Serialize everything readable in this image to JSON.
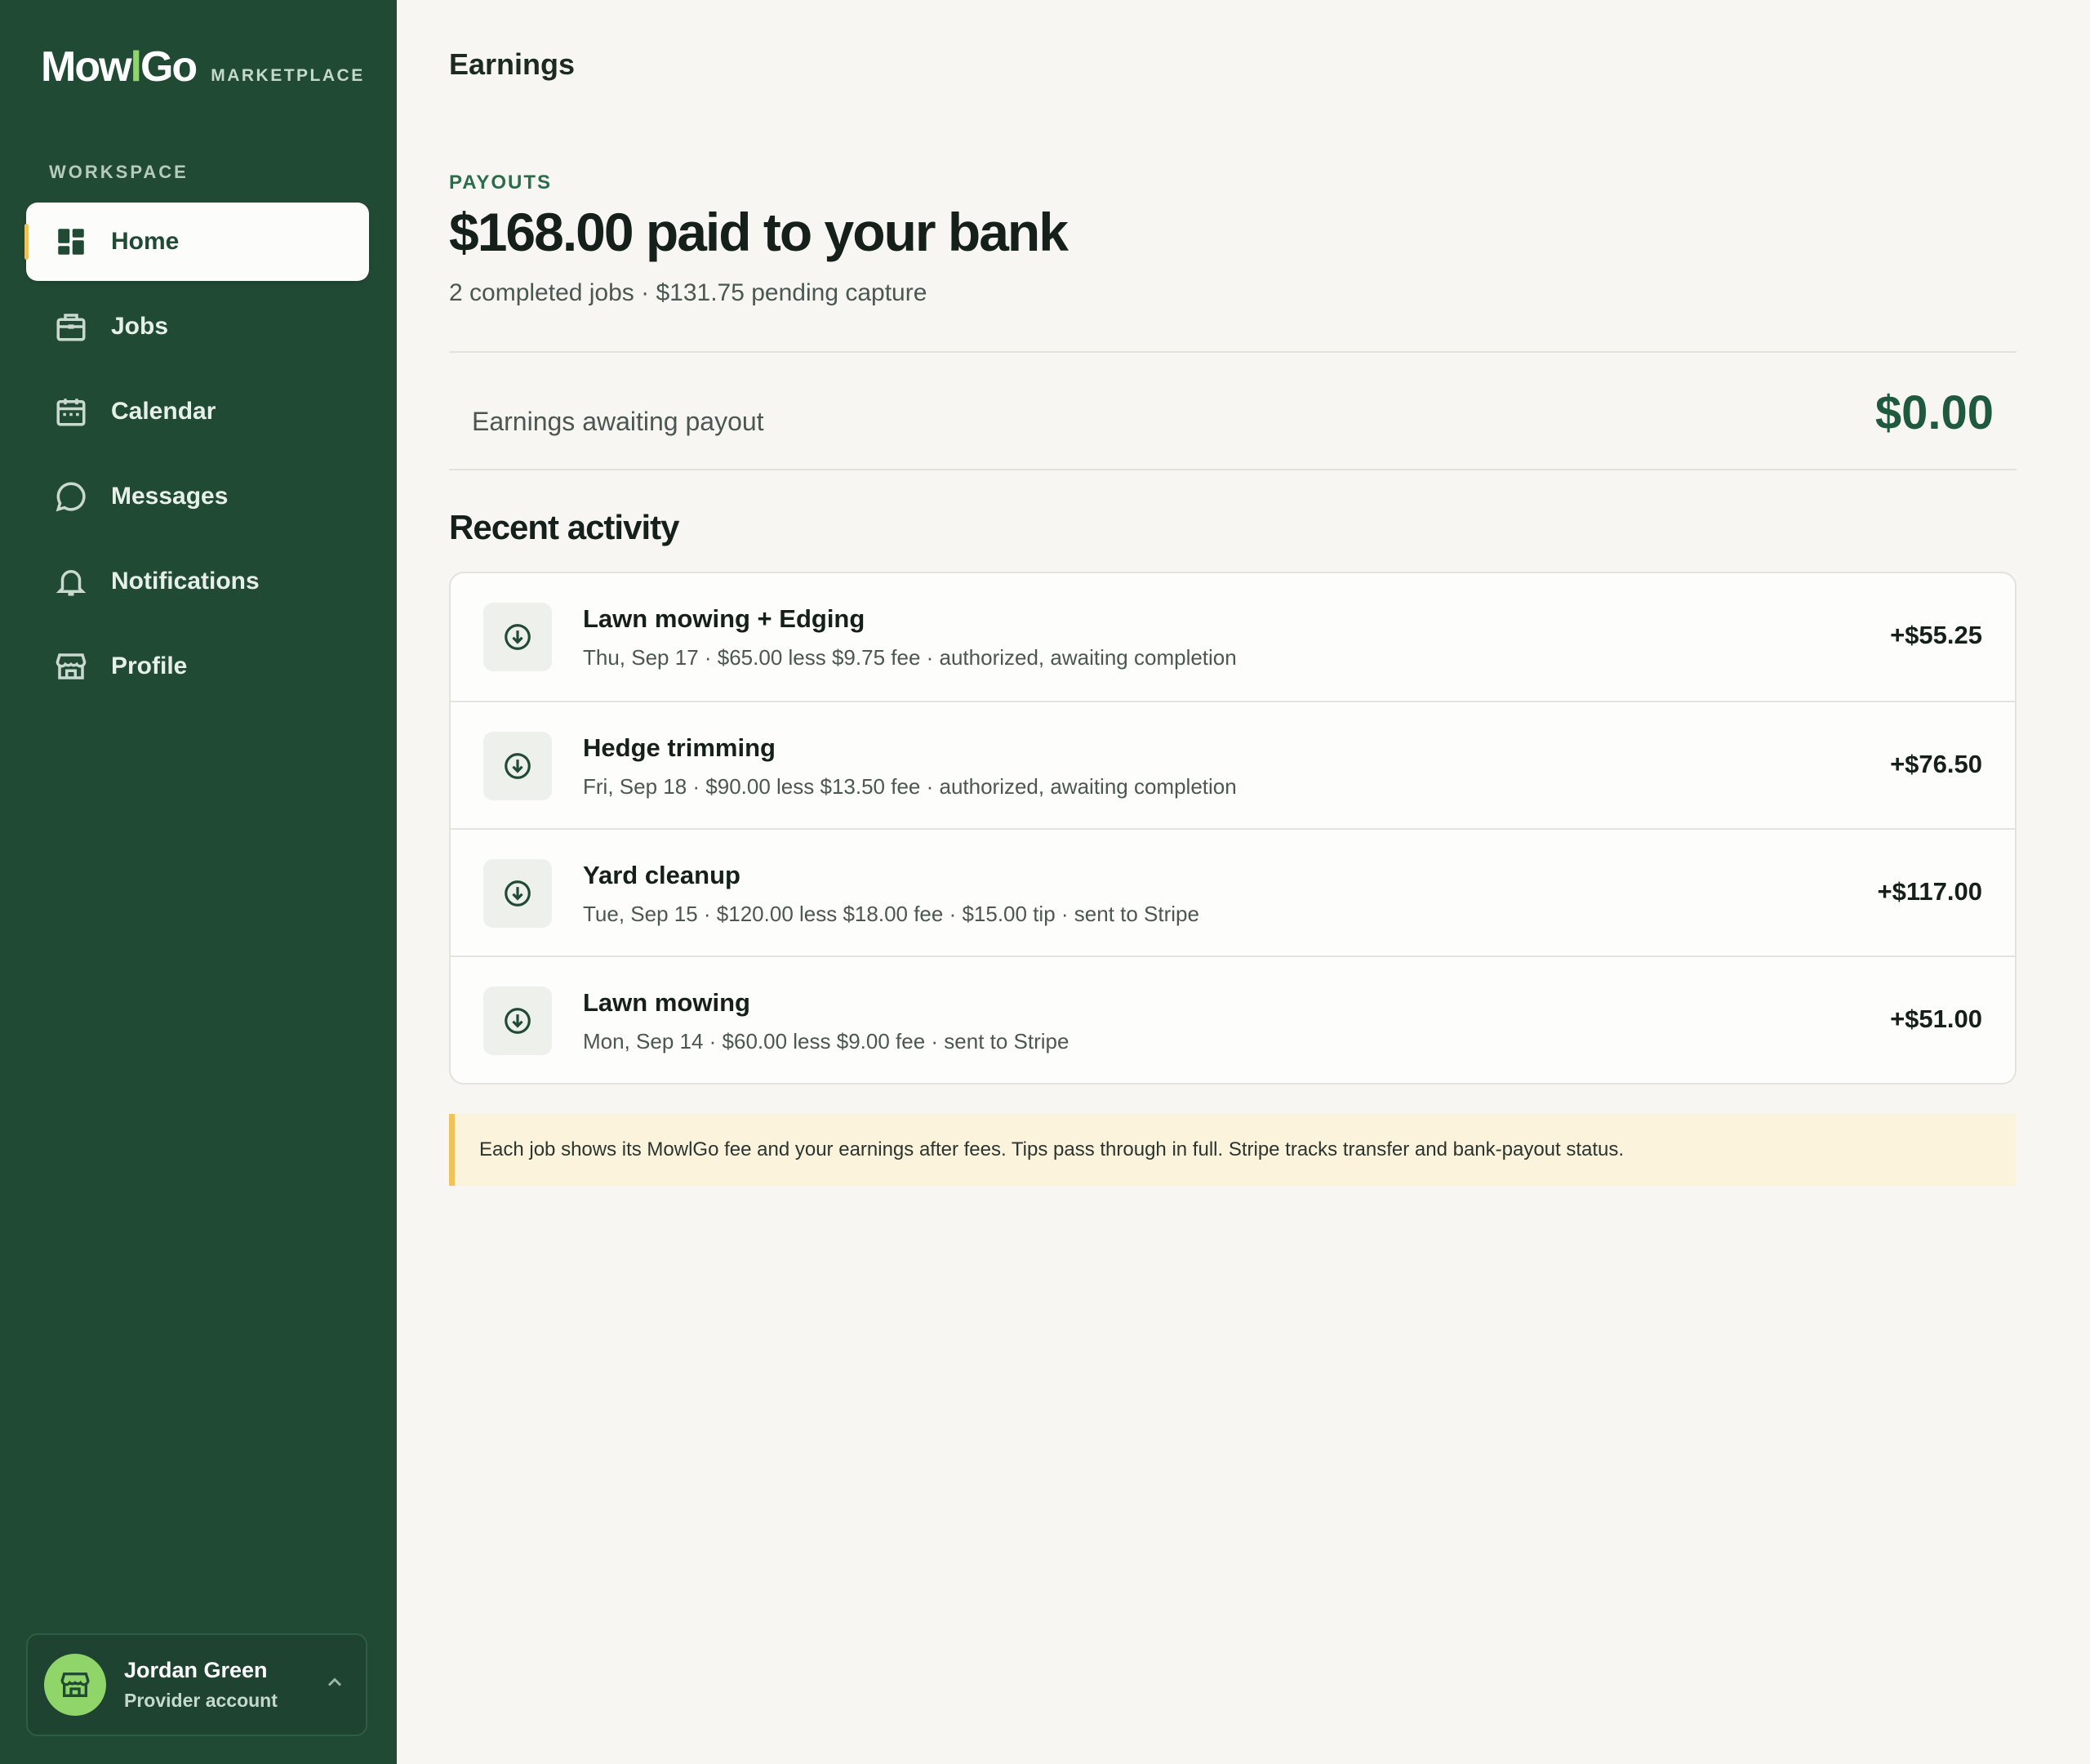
{
  "brand": {
    "logo_left": "Mow",
    "logo_bar": "l",
    "logo_right": "Go",
    "subtitle": "MARKETPLACE"
  },
  "sidebar": {
    "section_label": "WORKSPACE",
    "items": [
      {
        "label": "Home",
        "icon": "dashboard-icon",
        "active": true
      },
      {
        "label": "Jobs",
        "icon": "briefcase-icon"
      },
      {
        "label": "Calendar",
        "icon": "calendar-icon"
      },
      {
        "label": "Messages",
        "icon": "chat-bubble-icon"
      },
      {
        "label": "Notifications",
        "icon": "bell-icon"
      },
      {
        "label": "Profile",
        "icon": "storefront-icon"
      }
    ]
  },
  "account": {
    "name": "Jordan Green",
    "role": "Provider account",
    "icon": "storefront-icon"
  },
  "page": {
    "title": "Earnings",
    "eyebrow": "PAYOUTS",
    "headline": "$168.00 paid to your bank",
    "subline": "2 completed jobs · $131.75 pending capture"
  },
  "awaiting": {
    "label": "Earnings awaiting payout",
    "value": "$0.00"
  },
  "recent": {
    "title": "Recent activity",
    "items": [
      {
        "title": "Lawn mowing + Edging",
        "detail": "Thu, Sep 17 · $65.00 less $9.75 fee · authorized, awaiting completion",
        "amount": "+$55.25"
      },
      {
        "title": "Hedge trimming",
        "detail": "Fri, Sep 18 · $90.00 less $13.50 fee · authorized, awaiting completion",
        "amount": "+$76.50"
      },
      {
        "title": "Yard cleanup",
        "detail": "Tue, Sep 15 · $120.00 less $18.00 fee · $15.00 tip · sent to Stripe",
        "amount": "+$117.00"
      },
      {
        "title": "Lawn mowing",
        "detail": "Mon, Sep 14 · $60.00 less $9.00 fee · sent to Stripe",
        "amount": "+$51.00"
      }
    ]
  },
  "note": "Each job shows its MowlGo fee and your earnings after fees. Tips pass through in full. Stripe tracks transfer and bank-payout status.",
  "colors": {
    "sidebar": "#214a35",
    "accent": "#8fd56a",
    "highlight": "#f0c35a",
    "money": "#1f5a3e"
  }
}
